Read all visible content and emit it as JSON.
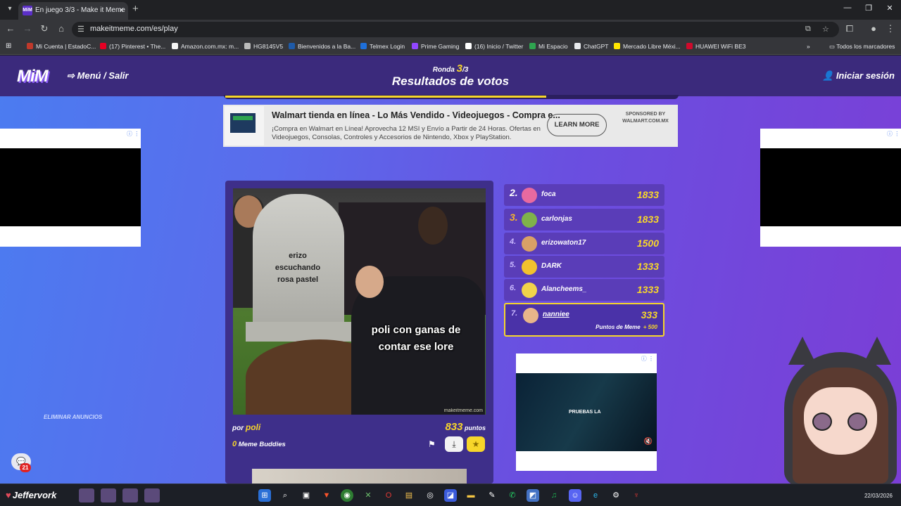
{
  "browser": {
    "tab_title": "En juego 3/3 - Make it Meme",
    "tab_favicon": "MiM",
    "url": "makeitmeme.com/es/play",
    "bookmarks": [
      {
        "label": "Mi Cuenta | EstadoC...",
        "color": "#c0392b"
      },
      {
        "label": "(17) Pinterest • The...",
        "color": "#e60023"
      },
      {
        "label": "Amazon.com.mx: m...",
        "color": "#f5f5f5"
      },
      {
        "label": "HG8145V5",
        "color": "#bbbbbb"
      },
      {
        "label": "Bienvenidos a la Ba...",
        "color": "#1e5aa8"
      },
      {
        "label": "Telmex Login",
        "color": "#1e6fd9"
      },
      {
        "label": "Prime Gaming",
        "color": "#9146ff"
      },
      {
        "label": "(16) Inicio / Twitter",
        "color": "#ffffff"
      },
      {
        "label": "Mi Espacio",
        "color": "#2ea44f"
      },
      {
        "label": "ChatGPT",
        "color": "#e8eaed"
      },
      {
        "label": "Mercado Libre Méxi...",
        "color": "#ffe600"
      },
      {
        "label": "HUAWEI WiFi BE3",
        "color": "#cf0a2c"
      }
    ],
    "bookmarks_folder": "Todos los marcadores"
  },
  "header": {
    "logo": "MiM",
    "menu_label": "Menú / Salir",
    "round_label": "Ronda",
    "round_number": "3",
    "round_total": "/3",
    "title": "Resultados de votos",
    "login_label": "Iniciar sesión",
    "round_progress": 0.71
  },
  "top_ad": {
    "title": "Walmart tienda en línea - Lo Más Vendido - Videojuegos - Compra e...",
    "text": "¡Compra en Walmart en Línea! Aprovecha 12 MSI y Envío a Partir de 24 Horas. Ofertas en Videojuegos, Consolas, Controles y Accesorios de Nintendo, Xbox y PlayStation.",
    "cta": "LEARN MORE",
    "sponsor_label": "SPONSORED BY",
    "sponsor": "WALMART.COM.MX"
  },
  "meme": {
    "caption_tombstone": "erizo escuchando rosa pastel",
    "caption_main": "poli con ganas de contar ese lore",
    "watermark": "makeitmeme.com",
    "by_label": "por",
    "author": "poli",
    "points": "833",
    "points_label": "puntos",
    "buddies_count": "0",
    "buddies_label": "Meme Buddies"
  },
  "leaderboard": [
    {
      "rank": "2.",
      "name": "foca",
      "score": "1833",
      "avatar_color": "#e86aa0"
    },
    {
      "rank": "3.",
      "name": "carlonjas",
      "score": "1833",
      "avatar_color": "#7fb24a"
    },
    {
      "rank": "4.",
      "name": "erizowaton17",
      "score": "1500",
      "avatar_color": "#d9a066"
    },
    {
      "rank": "5.",
      "name": "DARK",
      "score": "1333",
      "avatar_color": "#f2c12e"
    },
    {
      "rank": "6.",
      "name": "Alancheems_",
      "score": "1333",
      "avatar_color": "#f1d34a"
    },
    {
      "rank": "7.",
      "name": "nanniee",
      "score": "333",
      "avatar_color": "#e8b58a",
      "sub_label": "Puntos de Meme",
      "sub_bonus": "+ 500"
    }
  ],
  "video_ad": {
    "text": "PRUEBAS LA"
  },
  "sidebar": {
    "remove_ads": "ELIMINAR ANUNCIOS",
    "chat_count": "21"
  },
  "taskbar": {
    "user": "Jeffervork",
    "date": "22/03/2026"
  }
}
